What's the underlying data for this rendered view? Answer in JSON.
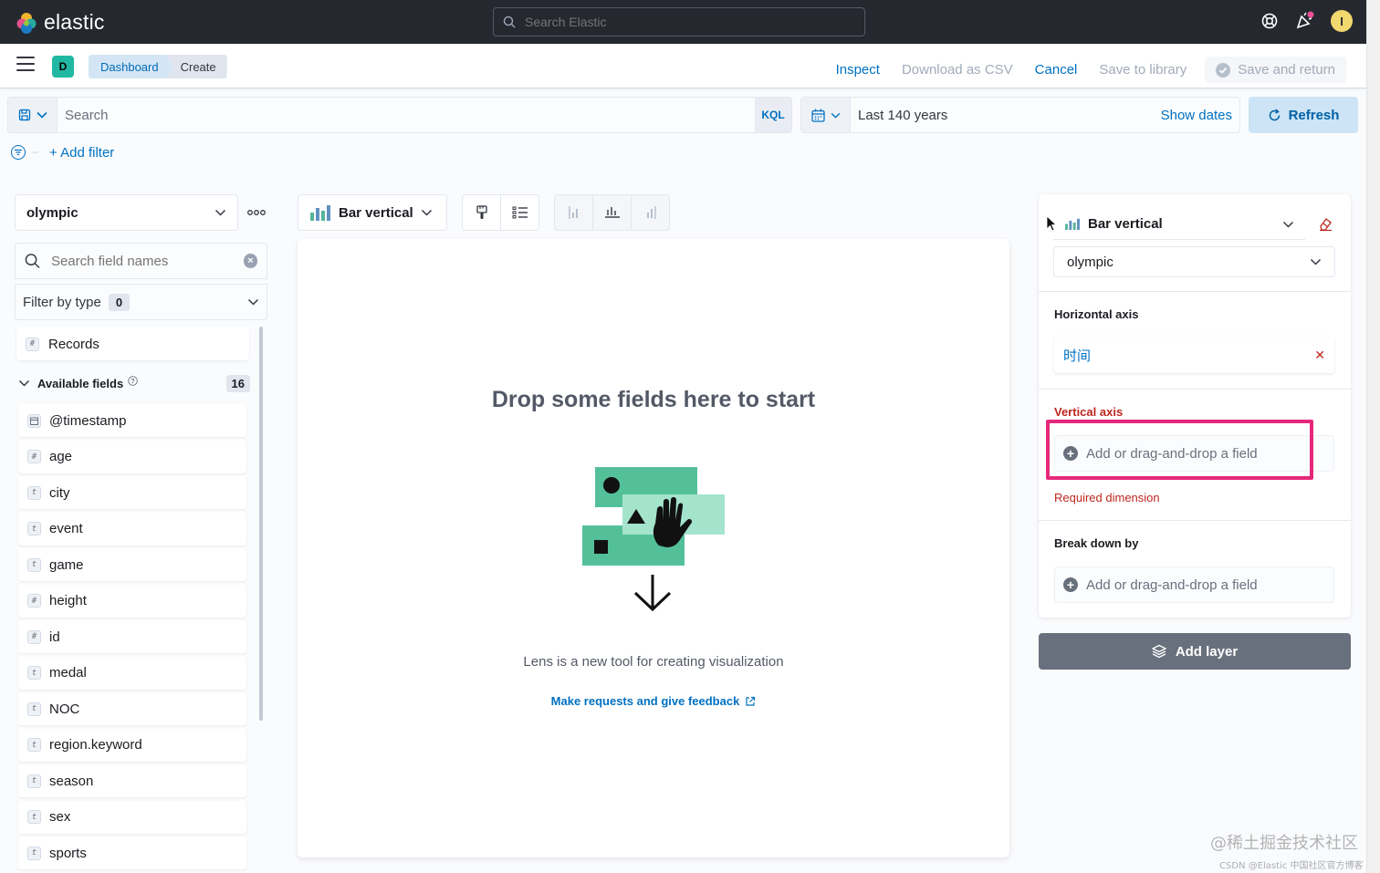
{
  "header": {
    "brand": "elastic",
    "search_placeholder": "Search Elastic",
    "user_initial": "I"
  },
  "appbar": {
    "space_initial": "D",
    "breadcrumbs": [
      "Dashboard",
      "Create"
    ],
    "actions": {
      "inspect": "Inspect",
      "download_csv": "Download as CSV",
      "cancel": "Cancel",
      "save_library": "Save to library",
      "save_return": "Save and return"
    }
  },
  "query": {
    "search_placeholder": "Search",
    "language": "KQL",
    "time_range": "Last 140 years",
    "show_dates": "Show dates",
    "refresh": "Refresh",
    "add_filter": "+ Add filter"
  },
  "sidebar": {
    "index_pattern": "olympic",
    "field_search_placeholder": "Search field names",
    "filter_by_type": "Filter by type",
    "filter_count": "0",
    "records": "Records",
    "available_fields_label": "Available fields",
    "available_fields_count": "16",
    "fields": [
      {
        "name": "@timestamp",
        "type": "date"
      },
      {
        "name": "age",
        "type": "#"
      },
      {
        "name": "city",
        "type": "t"
      },
      {
        "name": "event",
        "type": "t"
      },
      {
        "name": "game",
        "type": "t"
      },
      {
        "name": "height",
        "type": "#"
      },
      {
        "name": "id",
        "type": "#"
      },
      {
        "name": "medal",
        "type": "t"
      },
      {
        "name": "NOC",
        "type": "t"
      },
      {
        "name": "region.keyword",
        "type": "t"
      },
      {
        "name": "season",
        "type": "t"
      },
      {
        "name": "sex",
        "type": "t"
      },
      {
        "name": "sports",
        "type": "t"
      }
    ]
  },
  "workspace": {
    "chart_type": "Bar vertical",
    "drop_title": "Drop some fields here to start",
    "lens_text": "Lens is a new tool for creating visualization",
    "feedback_link": "Make requests and give feedback"
  },
  "config": {
    "layer_chart_type": "Bar vertical",
    "layer_index": "olympic",
    "horizontal_axis_label": "Horizontal axis",
    "horizontal_axis_field": "时间",
    "vertical_axis_label": "Vertical axis",
    "add_field_text": "Add or drag-and-drop a field",
    "required_text": "Required dimension",
    "break_down_label": "Break down by",
    "add_layer": "Add layer",
    "colors": {
      "required": "#bd271e",
      "highlight": "#e6287a",
      "accent": "#0071c2"
    }
  },
  "watermark": {
    "line1": "@稀土掘金技术社区",
    "line2": "CSDN @Elastic 中国社区官方博客"
  }
}
